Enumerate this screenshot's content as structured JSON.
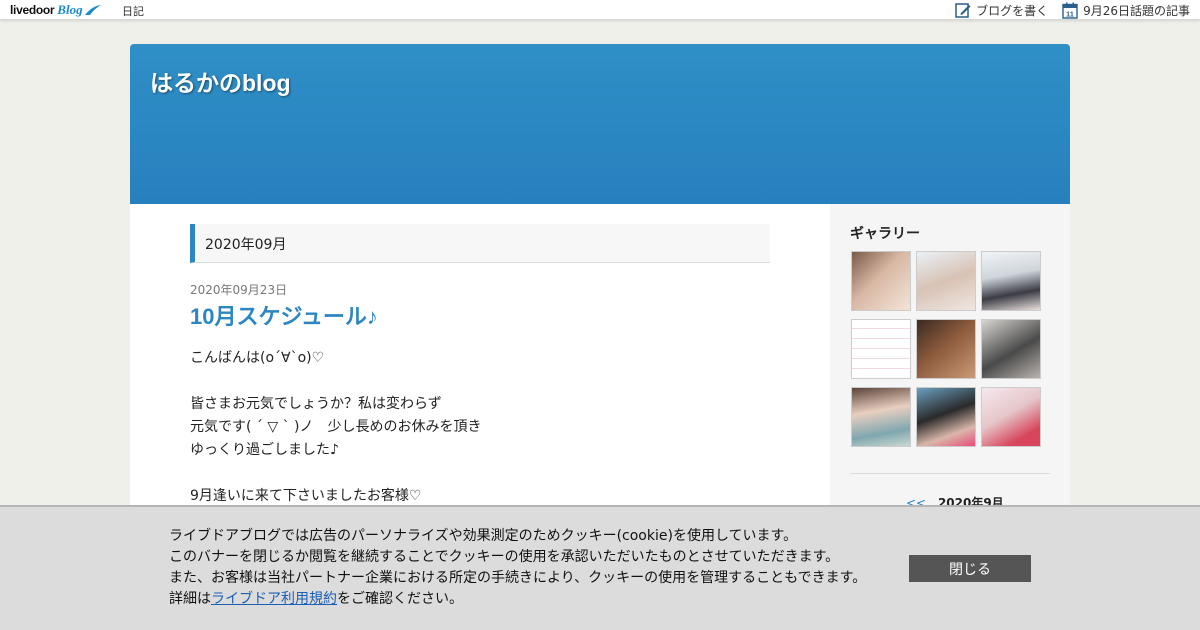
{
  "topbar": {
    "logo_text": "livedoor",
    "logo_blog": "Blog",
    "diary_link": "日記",
    "write_blog": "ブログを書く",
    "topic_link": "9月26日話題の記事",
    "calendar_day": "11"
  },
  "header": {
    "blog_title": "はるかのblog"
  },
  "main": {
    "month_heading": "2020年09月",
    "post": {
      "date": "2020年09月23日",
      "title": "10月スケジュール♪",
      "body_lines": [
        "こんばんは(o´∀`o)♡",
        "",
        "皆さまお元気でしょうか？私は変わらず",
        "元気です( ´ ▽ ` )ノ　少し長めのお休みを頂き",
        "ゆっくり過ごしました♪",
        "",
        "9月逢いに来て下さいましたお客様♡"
      ]
    }
  },
  "sidebar": {
    "gallery_title": "ギャラリー",
    "calendar": {
      "prev": "<<",
      "month": "2020年9月"
    }
  },
  "cookie_banner": {
    "line1": "ライブドアブログでは広告のパーソナライズや効果測定のためクッキー(cookie)を使用しています。",
    "line2": "このバナーを閉じるか閲覧を継続することでクッキーの使用を承認いただいたものとさせていただきます。",
    "line3": "また、お客様は当社パートナー企業における所定の手続きにより、クッキーの使用を管理することもできます。",
    "line4_prefix": "詳細は",
    "line4_link": "ライブドア利用規約",
    "line4_suffix": "をご確認ください。",
    "close_label": "閉じる"
  },
  "colors": {
    "accent": "#2b86c2",
    "header_bg": "#2f8fc6",
    "page_bg": "#f0f0eb",
    "banner_bg": "#dcdcdc",
    "button_bg": "#555555"
  }
}
